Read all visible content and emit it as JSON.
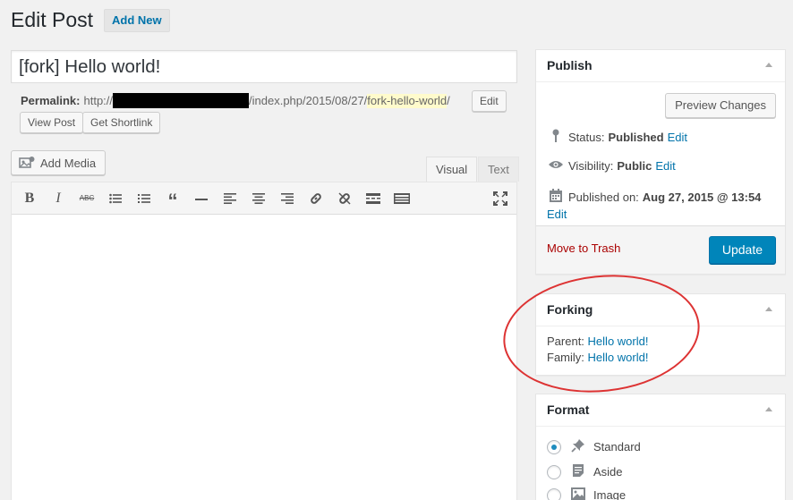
{
  "header": {
    "title": "Edit Post",
    "add_new": "Add New"
  },
  "post": {
    "title": "[fork] Hello world!"
  },
  "permalink": {
    "label": "Permalink:",
    "prefix": "http://",
    "path": "/index.php/2015/08/27/",
    "slug": "fork-hello-world",
    "suffix": "/",
    "edit": "Edit"
  },
  "buttons": {
    "view_post": "View Post",
    "get_shortlink": "Get Shortlink",
    "add_media": "Add Media"
  },
  "editor": {
    "tabs": [
      "Visual",
      "Text"
    ],
    "content": ""
  },
  "toolbar": {
    "icons": [
      "bold-icon",
      "italic-icon",
      "strikethrough-icon",
      "bullet-list-icon",
      "numbered-list-icon",
      "blockquote-icon",
      "horizontal-rule-icon",
      "align-left-icon",
      "align-center-icon",
      "align-right-icon",
      "insert-link-icon",
      "remove-link-icon",
      "read-more-icon",
      "toolbar-toggle-icon",
      "fullscreen-icon"
    ]
  },
  "publish": {
    "title": "Publish",
    "preview": "Preview Changes",
    "status_label": "Status:",
    "status_value": "Published",
    "visibility_label": "Visibility:",
    "visibility_value": "Public",
    "published_label": "Published on:",
    "published_value": "Aug 27, 2015 @ 13:54",
    "edit": "Edit",
    "trash": "Move to Trash",
    "update": "Update"
  },
  "forking": {
    "title": "Forking",
    "parent_label": "Parent:",
    "parent_link": "Hello world!",
    "family_label": "Family:",
    "family_link": "Hello world!"
  },
  "format": {
    "title": "Format",
    "options": [
      {
        "label": "Standard",
        "selected": true
      },
      {
        "label": "Aside",
        "selected": false
      },
      {
        "label": "Image",
        "selected": false
      }
    ]
  },
  "colors": {
    "primary": "#0085ba",
    "link": "#0073aa",
    "trash": "#a00",
    "annotation": "#d33"
  }
}
